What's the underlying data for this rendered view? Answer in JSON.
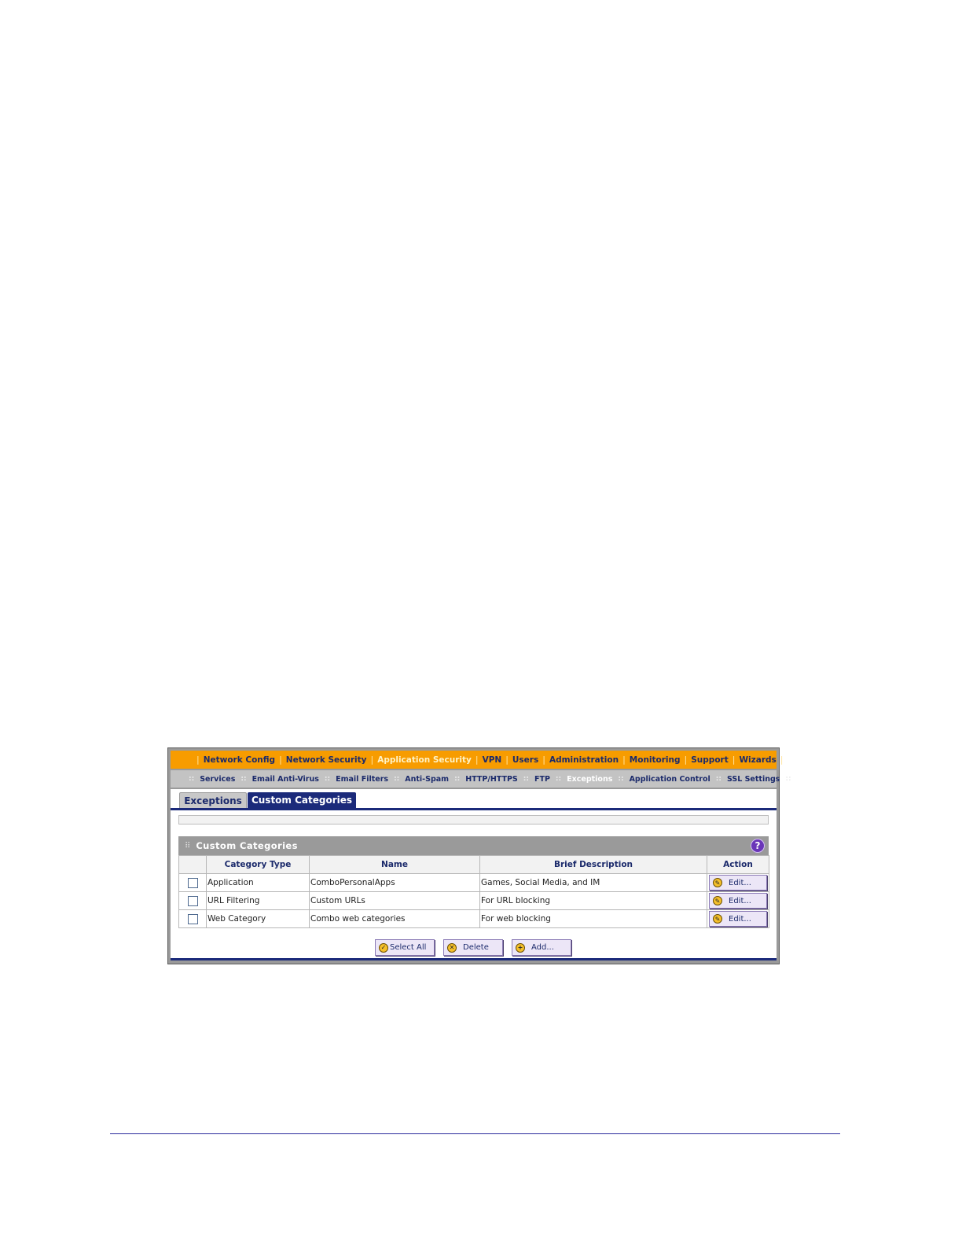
{
  "main_nav": {
    "items": [
      {
        "label": "Network Config",
        "active": false
      },
      {
        "label": "Network Security",
        "active": false
      },
      {
        "label": "Application Security",
        "active": true
      },
      {
        "label": "VPN",
        "active": false
      },
      {
        "label": "Users",
        "active": false
      },
      {
        "label": "Administration",
        "active": false
      },
      {
        "label": "Monitoring",
        "active": false
      },
      {
        "label": "Support",
        "active": false
      },
      {
        "label": "Wizards",
        "active": false
      }
    ],
    "separator": "|"
  },
  "sub_nav": {
    "items": [
      {
        "label": "Services",
        "active": false
      },
      {
        "label": "Email Anti-Virus",
        "active": false
      },
      {
        "label": "Email Filters",
        "active": false
      },
      {
        "label": "Anti-Spam",
        "active": false
      },
      {
        "label": "HTTP/HTTPS",
        "active": false
      },
      {
        "label": "FTP",
        "active": false
      },
      {
        "label": "Exceptions",
        "active": true
      },
      {
        "label": "Application Control",
        "active": false
      },
      {
        "label": "SSL Settings",
        "active": false
      }
    ],
    "separator": "::"
  },
  "tabs": [
    {
      "label": "Exceptions",
      "active": false
    },
    {
      "label": "Custom Categories",
      "active": true
    }
  ],
  "section": {
    "title": "Custom Categories",
    "help_icon": "?"
  },
  "table": {
    "headers": [
      "",
      "Category Type",
      "Name",
      "Brief Description",
      "Action"
    ],
    "rows": [
      {
        "category_type": "Application",
        "name": "ComboPersonalApps",
        "description": "Games, Social Media, and IM",
        "action": "Edit..."
      },
      {
        "category_type": "URL Filtering",
        "name": "Custom URLs",
        "description": "For URL blocking",
        "action": "Edit..."
      },
      {
        "category_type": "Web Category",
        "name": "Combo web categories",
        "description": "For web blocking",
        "action": "Edit..."
      }
    ]
  },
  "buttons": {
    "select_all": "Select All",
    "delete": "Delete",
    "add": "Add..."
  },
  "icons": {
    "edit": "edit-icon",
    "select_all": "checkmark-icon",
    "delete": "x-circle-icon",
    "add": "plus-circle-icon"
  },
  "colors": {
    "nav_orange": "#f79c00",
    "nav_text": "#1b2a6b",
    "active_tab": "#1b2a7a",
    "help_purple": "#6a36b8",
    "footer_rule": "#2b2a9c"
  }
}
